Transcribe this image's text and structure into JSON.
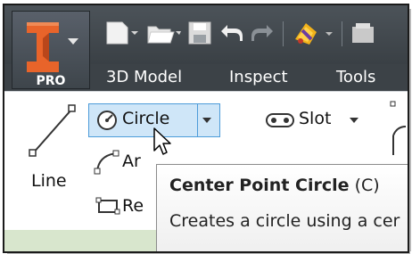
{
  "app": {
    "edition_badge": "PRO",
    "accent_color": "#e8642a"
  },
  "quick_access": {
    "icons": [
      "new-file-icon",
      "open-folder-icon",
      "save-icon",
      "undo-icon",
      "redo-icon",
      "material-icon"
    ]
  },
  "tabs": [
    {
      "label": "3D Model"
    },
    {
      "label": "Inspect"
    },
    {
      "label": "Tools"
    }
  ],
  "ribbon": {
    "line_label": "Line",
    "circle_label": "Circle",
    "slot_label": "Slot",
    "arc_label_partial": "Ar",
    "rect_label_partial": "Re"
  },
  "tooltip": {
    "title": "Center Point Circle",
    "shortcut": "(C)",
    "description": "Creates a circle using a cer"
  }
}
